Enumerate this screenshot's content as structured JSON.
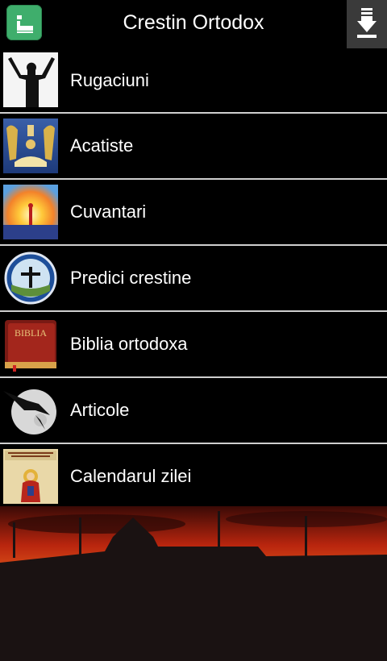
{
  "header": {
    "title": "Crestin Ortodox"
  },
  "menu": {
    "items": [
      {
        "label": "Rugaciuni",
        "icon": "praying-person-icon"
      },
      {
        "label": "Acatiste",
        "icon": "angels-icon"
      },
      {
        "label": "Cuvantari",
        "icon": "sunrise-icon"
      },
      {
        "label": "Predici crestine",
        "icon": "cross-globe-icon"
      },
      {
        "label": "Biblia ortodoxa",
        "icon": "bible-icon"
      },
      {
        "label": "Articole",
        "icon": "moon-raven-icon"
      },
      {
        "label": "Calendarul zilei",
        "icon": "icon-calendar-icon"
      }
    ]
  },
  "thumb_text": {
    "bible": "BIBLIA"
  },
  "colors": {
    "background": "#000000",
    "app_icon": "#3fae6c",
    "divider": "#cfcfcf"
  }
}
